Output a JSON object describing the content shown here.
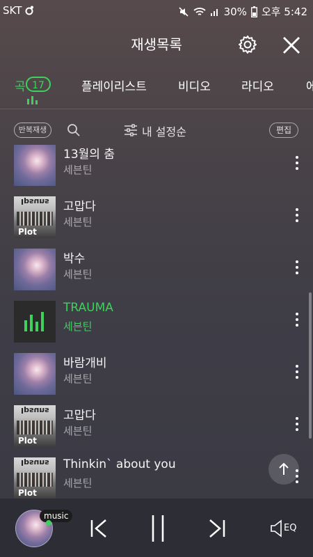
{
  "statusbar": {
    "carrier": "SKT",
    "battery": "30%",
    "time": "오후 5:42"
  },
  "header": {
    "title": "재생목록"
  },
  "tabs": [
    {
      "label": "곡",
      "badge": "17",
      "active": true
    },
    {
      "label": "플레이리스트"
    },
    {
      "label": "비디오"
    },
    {
      "label": "라디오"
    },
    {
      "label": "에"
    }
  ],
  "toolbar": {
    "repeat_label": "반복재생",
    "sort_label": "내 설정순",
    "edit_label": "편집"
  },
  "songs": [
    {
      "title": "13월의 춤",
      "artist": "세븐틴",
      "art": "cloud"
    },
    {
      "title": "고맙다",
      "artist": "세븐틴",
      "art": "plot"
    },
    {
      "title": "박수",
      "artist": "세븐틴",
      "art": "cloud"
    },
    {
      "title": "TRAUMA",
      "artist": "세븐틴",
      "art": "dark",
      "playing": true
    },
    {
      "title": "바람개비",
      "artist": "세븐틴",
      "art": "cloud"
    },
    {
      "title": "고맙다",
      "artist": "세븐틴",
      "art": "plot"
    },
    {
      "title": "Thinkin` about you",
      "artist": "세븐틴",
      "art": "plot"
    }
  ],
  "album_art_text": {
    "plot_bottom": "Plot",
    "plot_top": "Ipsuns"
  },
  "player": {
    "badge_label": "music",
    "eq_label": "EQ"
  },
  "colors": {
    "accent": "#3ed15d"
  }
}
